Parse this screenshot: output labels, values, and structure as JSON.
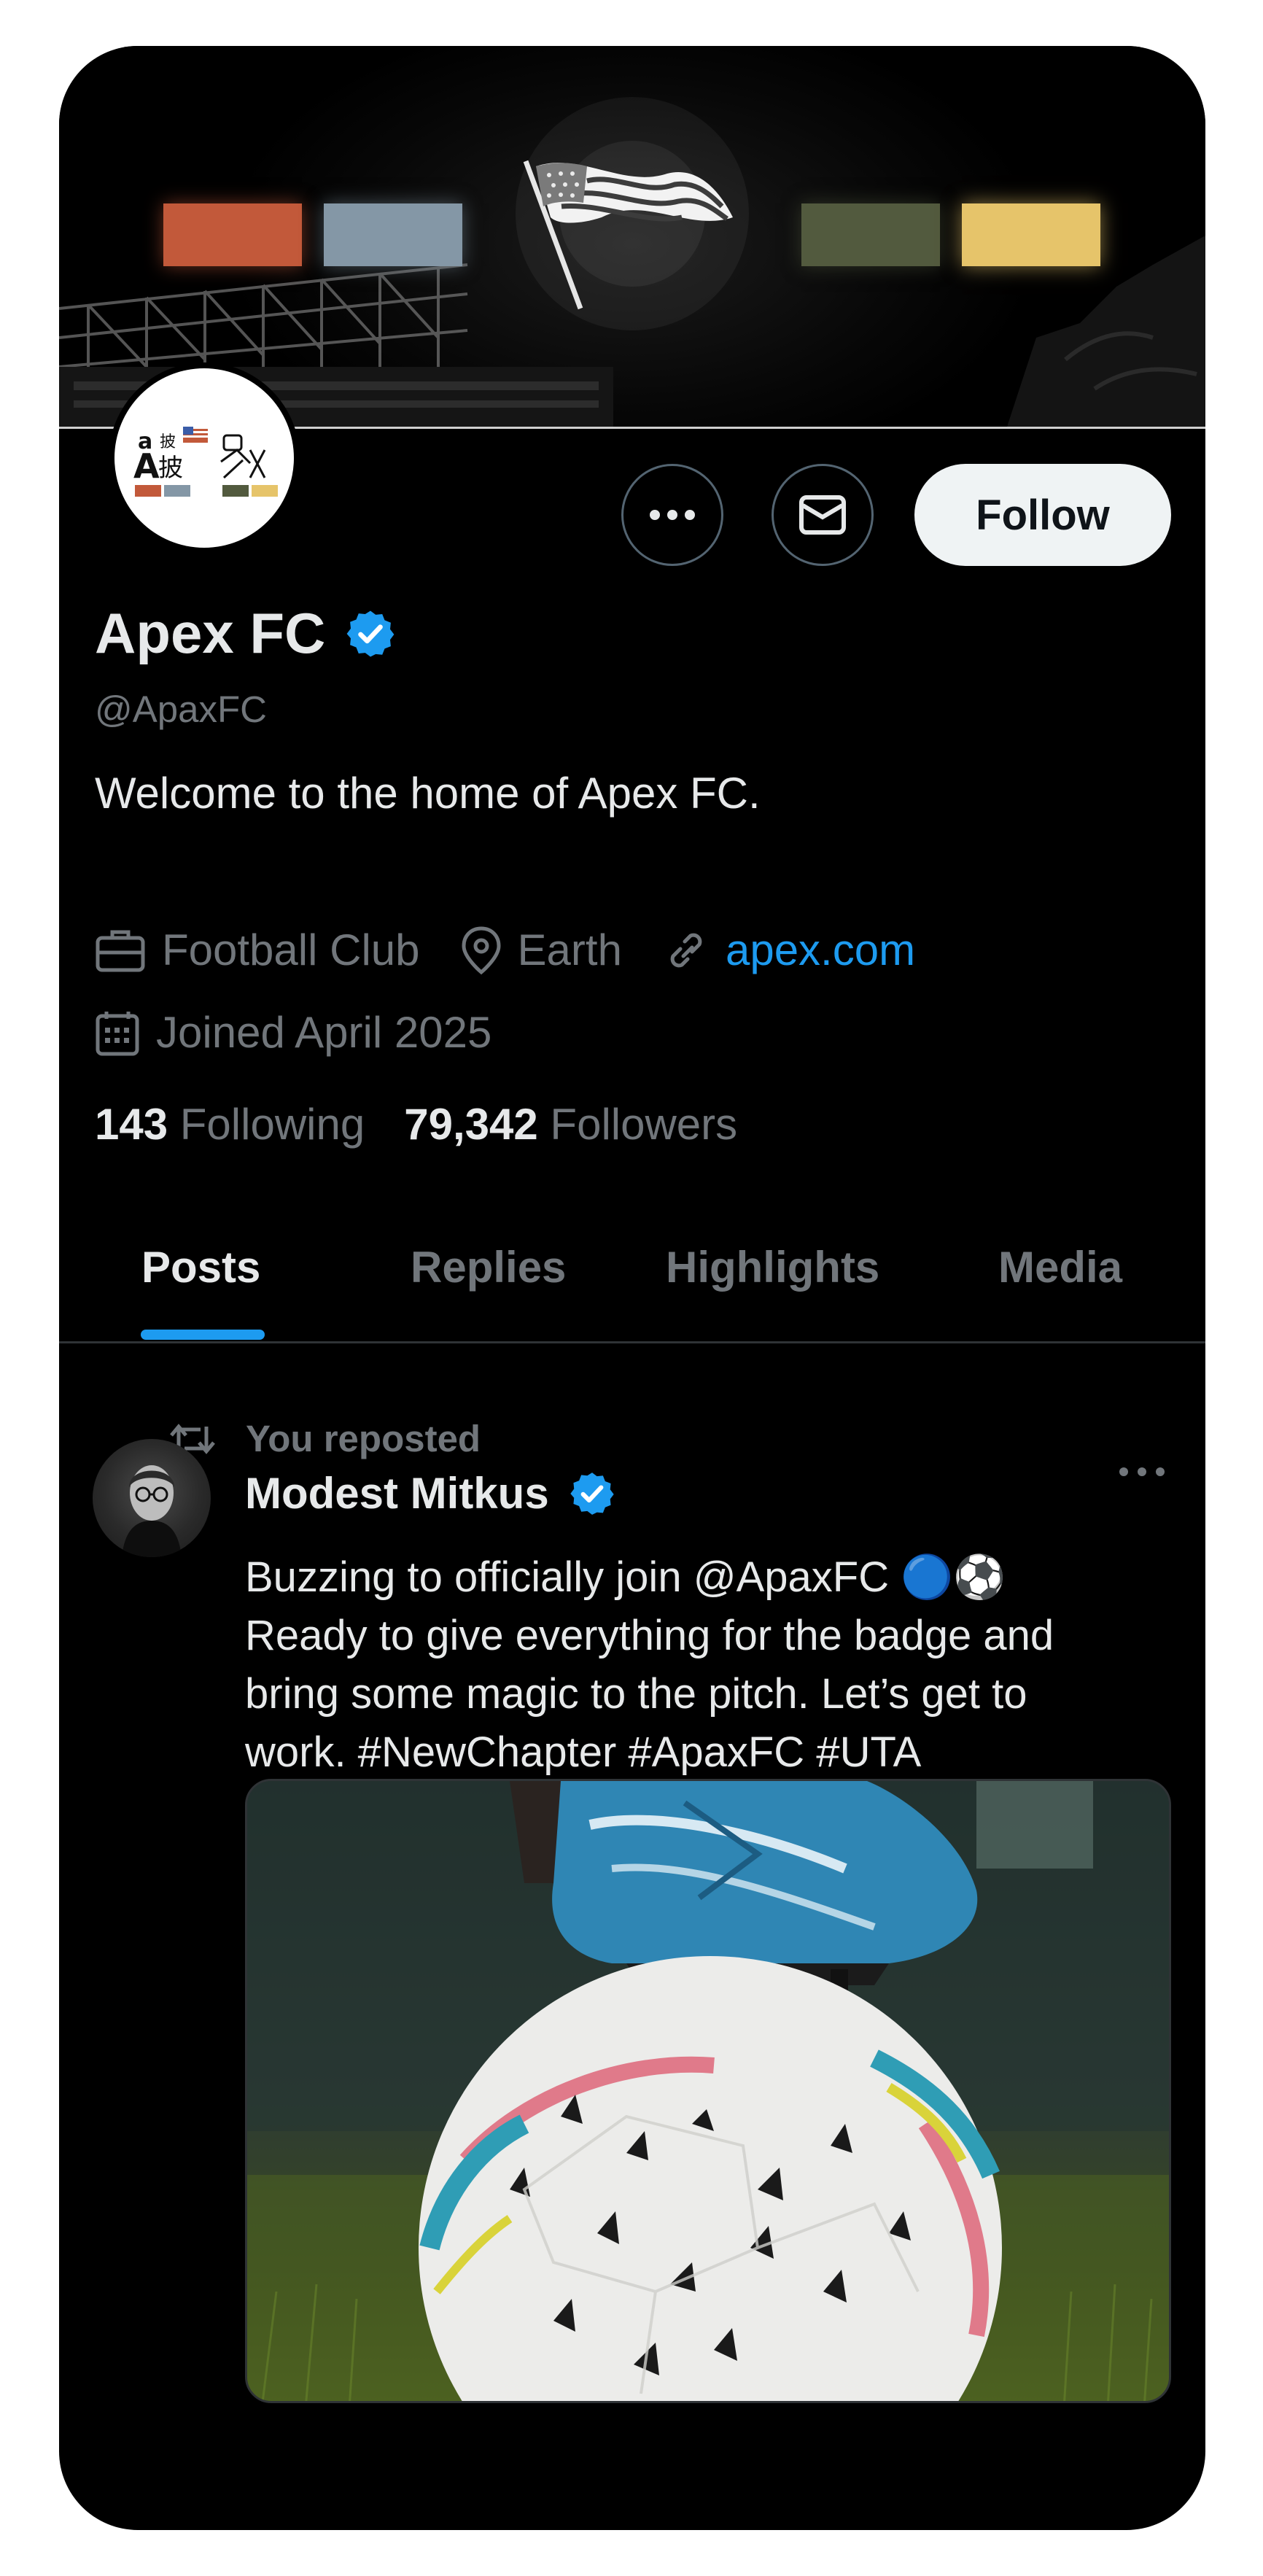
{
  "banner": {
    "swatch_colors": [
      "#c2593a",
      "#8497a6",
      "#525a3e",
      "#e6c46a"
    ]
  },
  "avatar": {
    "logo_text": "a 披 A披"
  },
  "actions": {
    "more_icon": "more-horizontal-icon",
    "message_icon": "envelope-icon",
    "follow_label": "Follow"
  },
  "profile": {
    "name": "Apex FC",
    "verified_icon": "verified-badge-icon",
    "handle": "@ApaxFC",
    "bio": "Welcome to the home of Apex FC.",
    "category": "Football Club",
    "location": "Earth",
    "website": "apex.com",
    "joined": "Joined April 2025",
    "following_count": "143",
    "following_label": "Following",
    "followers_count": "79,342",
    "followers_label": "Followers"
  },
  "tabs": [
    {
      "label": "Posts",
      "active": true
    },
    {
      "label": "Replies",
      "active": false
    },
    {
      "label": "Highlights",
      "active": false
    },
    {
      "label": "Media",
      "active": false
    }
  ],
  "post": {
    "repost_label": "You reposted",
    "author_name": "Modest Mitkus",
    "lines": [
      "Buzzing to officially join @ApaxFC 🔵⚽",
      "Ready to give everything for the badge and",
      "bring some magic to the pitch. Let’s get to",
      "work. #NewChapter #ApaxFC #UTA"
    ]
  },
  "colors": {
    "background": "#000000",
    "accent": "#1d9bf0",
    "text_primary": "#e7e9ea",
    "text_secondary": "#71767b",
    "follow_button_bg": "#eff3f4"
  }
}
